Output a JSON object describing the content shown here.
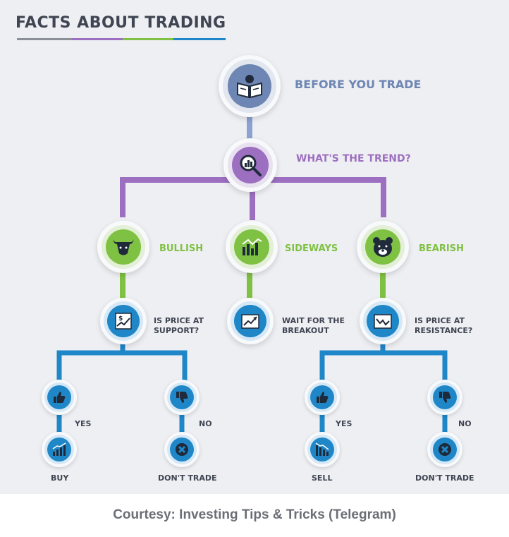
{
  "title": "FACTS ABOUT TRADING",
  "colors": {
    "panel": "#eeeff3",
    "title": "#3f4552",
    "blue_gray": "#6e86b3",
    "purple": "#9d6fc0",
    "green": "#7fc142",
    "blue": "#1f87c8",
    "text_dark": "#3f4552"
  },
  "nodes": {
    "before": {
      "label": "BEFORE YOU TRADE",
      "icon": "book-reader-icon"
    },
    "trend": {
      "label": "WHAT'S THE TREND?",
      "icon": "magnifier-chart-icon"
    },
    "bullish": {
      "label": "BULLISH",
      "icon": "bull-icon"
    },
    "sideways": {
      "label": "SIDEWAYS",
      "icon": "bar-chart-icon"
    },
    "bearish": {
      "label": "BEARISH",
      "icon": "bear-icon"
    },
    "support": {
      "label_line1": "IS PRICE AT",
      "label_line2": "SUPPORT?",
      "icon": "price-chart-icon"
    },
    "breakout": {
      "label_line1": "WAIT FOR THE",
      "label_line2": "BREAKOUT",
      "icon": "rising-chart-icon"
    },
    "resistance": {
      "label_line1": "IS PRICE AT",
      "label_line2": "RESISTANCE?",
      "icon": "line-chart-icon"
    },
    "yes_left": {
      "label": "YES",
      "icon": "thumbs-up-icon"
    },
    "no_left": {
      "label": "NO",
      "icon": "thumbs-down-icon"
    },
    "yes_right": {
      "label": "YES",
      "icon": "thumbs-up-icon"
    },
    "no_right": {
      "label": "NO",
      "icon": "thumbs-down-icon"
    },
    "buy": {
      "label": "BUY",
      "icon": "growth-chart-icon"
    },
    "dont_trade_left": {
      "label": "DON'T TRADE",
      "icon": "x-icon"
    },
    "sell": {
      "label": "SELL",
      "icon": "decline-chart-icon"
    },
    "dont_trade_right": {
      "label": "DON'T TRADE",
      "icon": "x-icon"
    }
  },
  "footer": "Courtesy: Investing Tips & Tricks (Telegram)"
}
